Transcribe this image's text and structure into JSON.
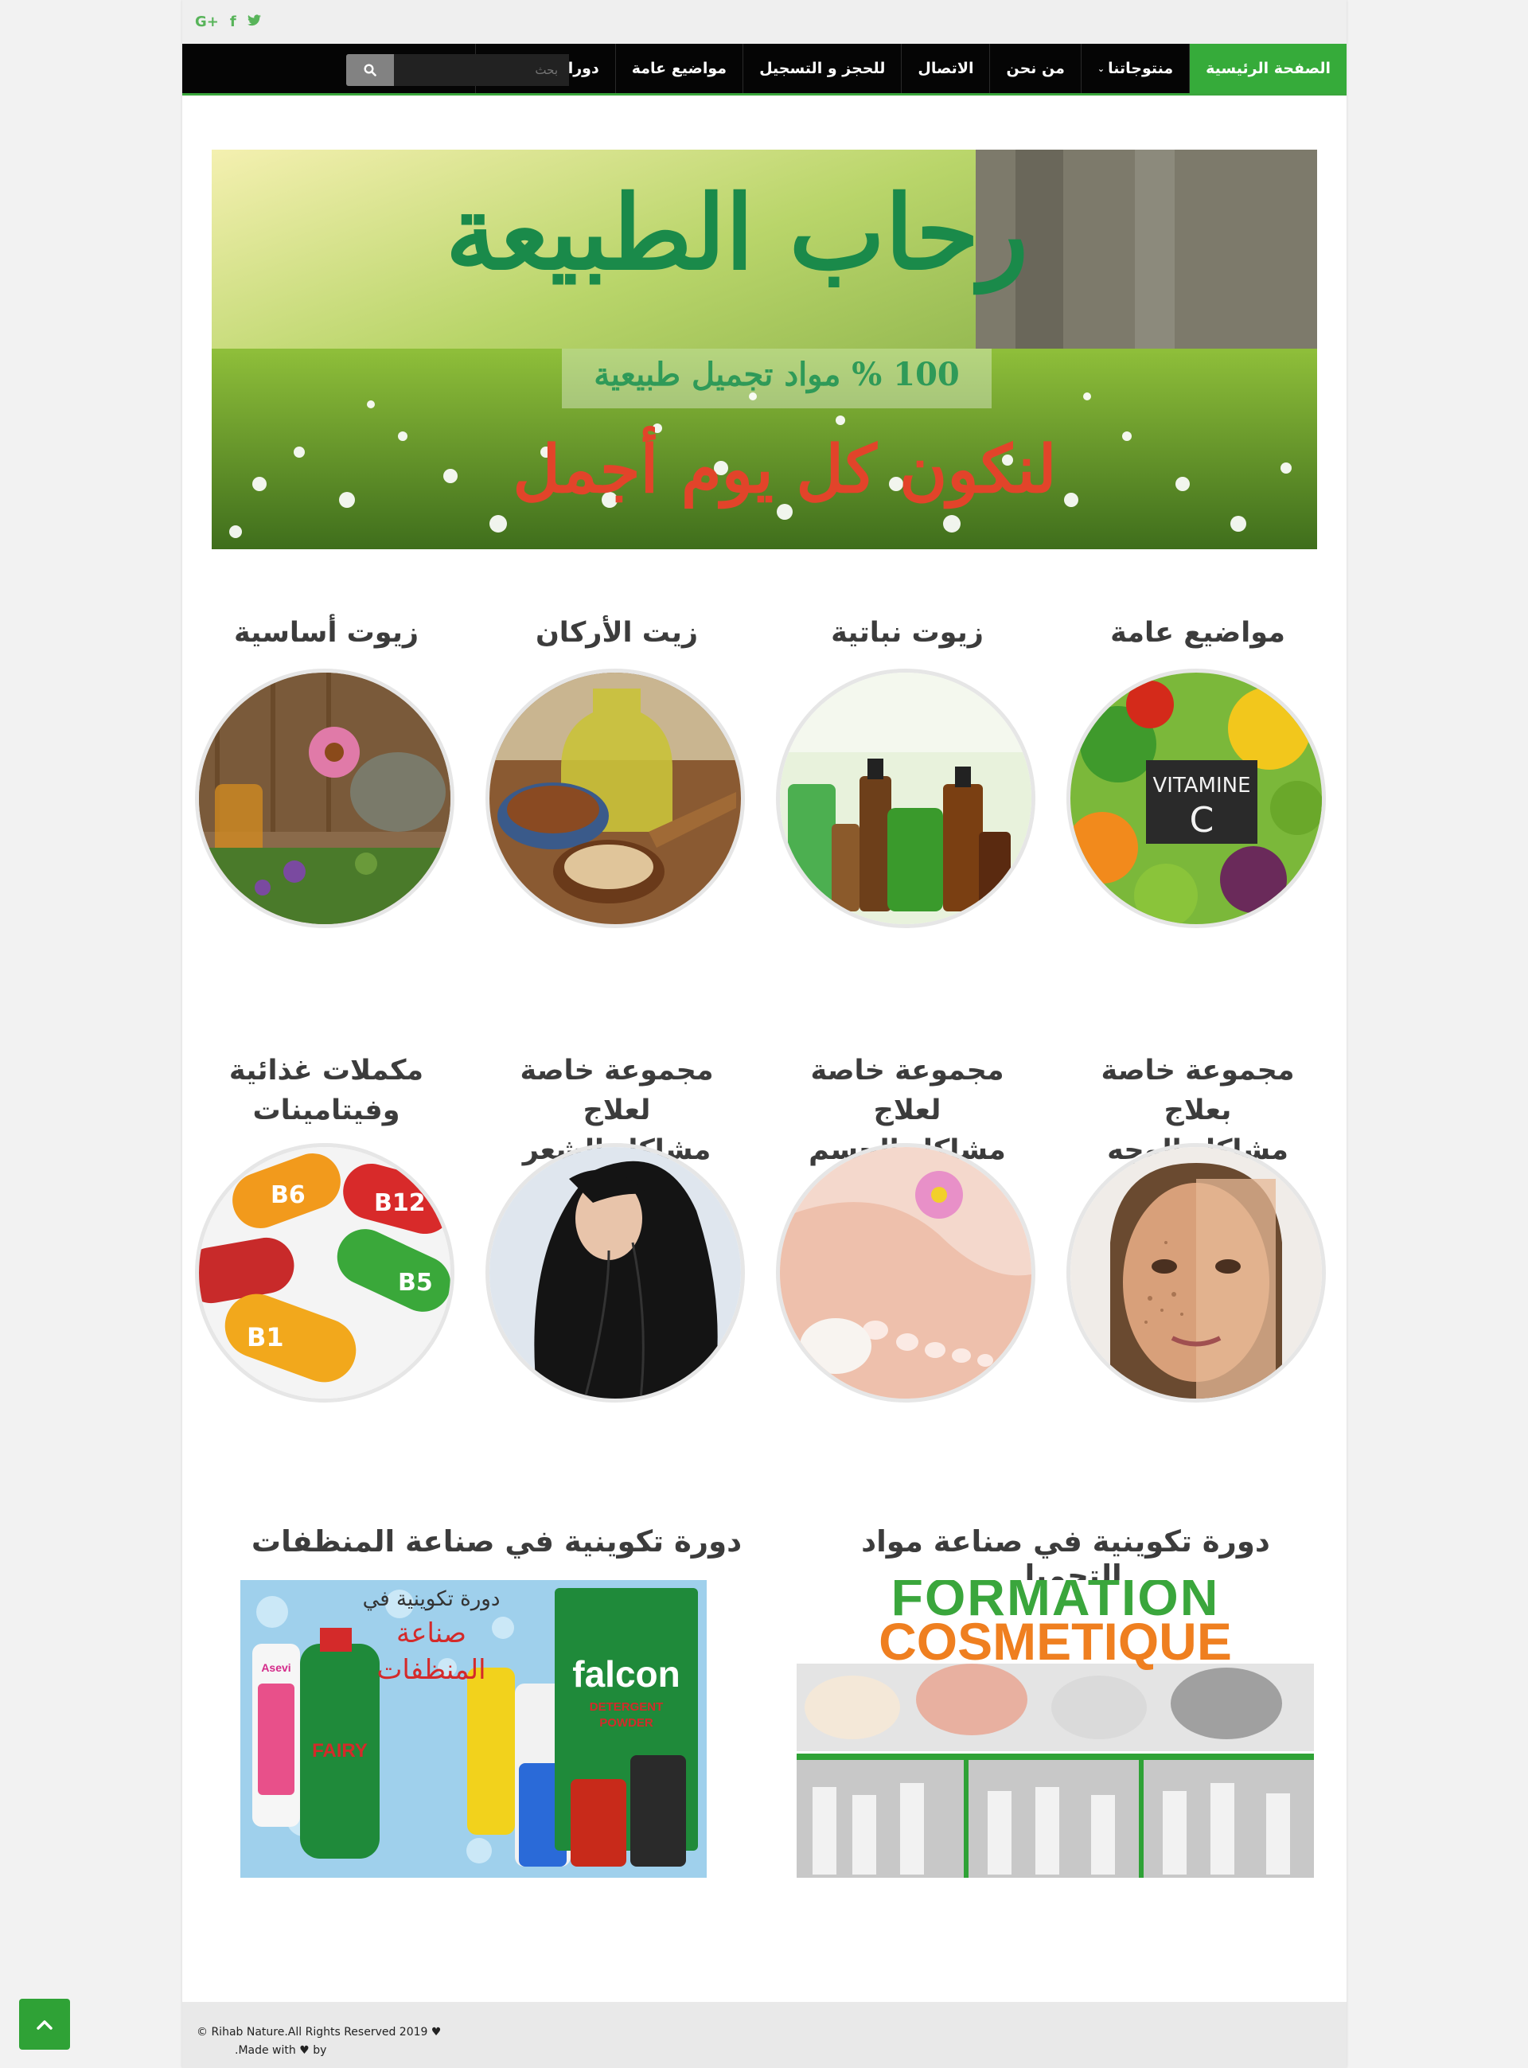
{
  "social": {
    "google_plus": "G+",
    "facebook": "f",
    "twitter": "t"
  },
  "nav": {
    "items": [
      {
        "label": "الصفحة الرئيسية",
        "active": true
      },
      {
        "label": "منتوجاتنا",
        "has_dropdown": true
      },
      {
        "label": "من نحن"
      },
      {
        "label": "الاتصال"
      },
      {
        "label": "للحجز و التسجيل"
      },
      {
        "label": "مواضيع عامة"
      },
      {
        "label": "دوراتنا المقبلة"
      }
    ],
    "search_placeholder": "بحث",
    "active_color": "#36ab3a"
  },
  "slider": {
    "title": "رحاب الطبيعة",
    "subtitle": "100 % مواد تجميل طبيعية",
    "tagline": "لنكون كل يوم أجمل",
    "slide_count": 5,
    "active_slide": 1
  },
  "categories_row1": [
    {
      "title": "مواضيع عامة",
      "icon": "vitamin-c-fruits-image"
    },
    {
      "title": "زيوت نباتية",
      "icon": "oil-bottles-image"
    },
    {
      "title": "زيت الأركان",
      "icon": "argan-oil-image"
    },
    {
      "title": "زيوت أساسية",
      "icon": "essential-oils-image"
    }
  ],
  "categories_row2": [
    {
      "title_line1": "مجموعة خاصة بعلاج",
      "title_line2": "مشاكل الوجه",
      "icon": "face-image"
    },
    {
      "title_line1": "مجموعة خاصة لعلاج",
      "title_line2": "مشاكل الجسم",
      "icon": "feet-image"
    },
    {
      "title_line1": "مجموعة خاصة لعلاج",
      "title_line2": "مشاكل الشعر",
      "icon": "hair-image"
    },
    {
      "title_line1": "مكملات غذائية",
      "title_line2": "وفيتامينات",
      "icon": "vitamin-capsules-image"
    }
  ],
  "courses": [
    {
      "title": "دورة تكوينية في صناعة مواد التجميل",
      "image_text_1": "FORMATION",
      "image_text_2": "COSMETIQUE"
    },
    {
      "title": "دورة تكوينية في صناعة المنظفات",
      "image_text_1": "دورة تكوينية في",
      "image_text_2": "صناعة",
      "image_text_3": "المنظفات",
      "brand_1": "FAIRY",
      "brand_2": "falcon",
      "brand_3": "DETERGENT POWDER",
      "brand_4": "Asevi"
    }
  ],
  "footer": {
    "copyright": "© Rihab Nature.All Rights Reserved 2019 ♥",
    "made_with": "Made with",
    "by": "by",
    "period": "."
  },
  "colors": {
    "accent": "#36ab3a",
    "nav_bg": "#050505",
    "title_text": "#3c3c3c"
  }
}
